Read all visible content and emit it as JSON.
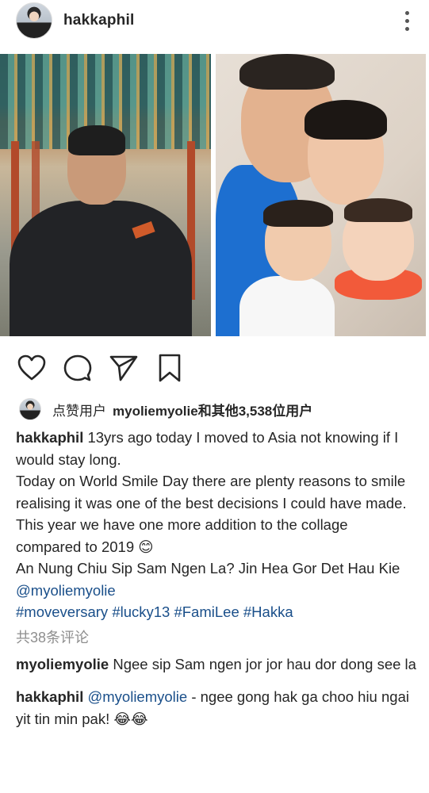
{
  "header": {
    "username": "hakkaphil"
  },
  "likes": {
    "prefix": "点赞用户",
    "summary": "myoliemyolie和其他3,538位用户"
  },
  "caption": {
    "username": "hakkaphil",
    "lines": [
      "13yrs ago today I moved to Asia not knowing if I would stay long.",
      "Today on World Smile Day there are plenty reasons to smile realising it was one of the best decisions I could have made.",
      "This year we have one more addition to the collage compared to 2019 😊",
      "An Nung Chiu Sip Sam Ngen La? Jin Hea Gor Det Hau Kie"
    ],
    "mention": "@myoliemyolie",
    "hashtags": "#moveversary #lucky13 #FamiLee #Hakka"
  },
  "view_comments": "共38条评论",
  "comments": [
    {
      "username": "myoliemyolie",
      "text": "Ngee sip Sam ngen jor jor hau dor dong see la"
    },
    {
      "username": "hakkaphil",
      "mention": "@myoliemyolie",
      "text": " - ngee gong hak ga choo hiu ngai yit tin min pak! 😂😂"
    }
  ],
  "icons": {
    "like": "heart-outline-icon",
    "comment": "comment-bubble-icon",
    "share": "paper-plane-icon",
    "save": "bookmark-icon",
    "more": "more-vertical-icon"
  },
  "colors": {
    "text": "#262626",
    "secondary": "#8e8e8e",
    "link": "#1a4f8a"
  }
}
